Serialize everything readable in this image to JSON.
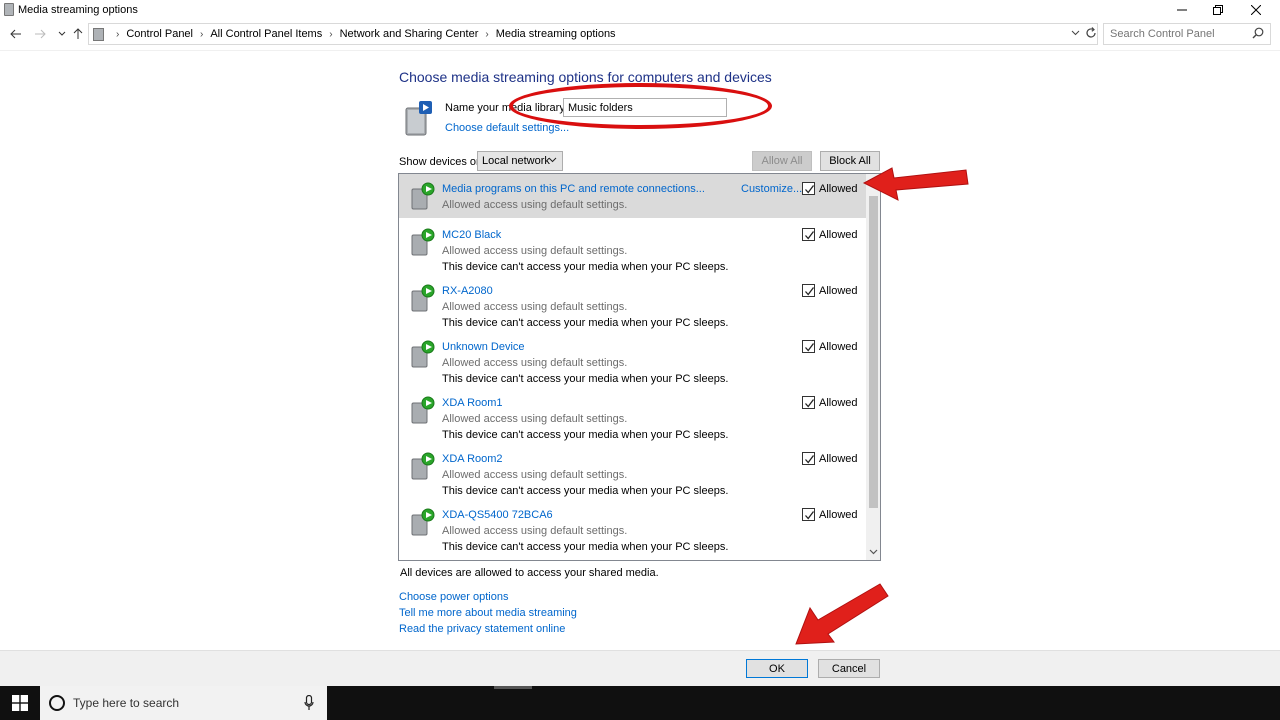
{
  "window": {
    "title": "Media streaming options"
  },
  "address": {
    "crumbs": [
      "Control Panel",
      "All Control Panel Items",
      "Network and Sharing Center",
      "Media streaming options"
    ],
    "search_placeholder": "Search Control Panel"
  },
  "content": {
    "heading": "Choose media streaming options for computers and devices",
    "library_label": "Name your media library:",
    "library_value": "Music folders",
    "default_settings_link": "Choose default settings...",
    "show_devices_label": "Show devices on:",
    "show_devices_value": "Local network",
    "allow_all": "Allow All",
    "block_all": "Block All"
  },
  "devices": [
    {
      "name": "Media programs on this PC and remote connections...",
      "sub1": "Allowed access using default settings.",
      "sub2": "",
      "customize": "Customize...",
      "status": "Allowed",
      "checked": true,
      "selected": true
    },
    {
      "name": "MC20 Black",
      "sub1": "Allowed access using default settings.",
      "sub2": "This device can't access your media when your PC sleeps.",
      "status": "Allowed",
      "checked": true
    },
    {
      "name": "RX-A2080",
      "sub1": "Allowed access using default settings.",
      "sub2": "This device can't access your media when your PC sleeps.",
      "status": "Allowed",
      "checked": true
    },
    {
      "name": "Unknown Device",
      "sub1": "Allowed access using default settings.",
      "sub2": "This device can't access your media when your PC sleeps.",
      "status": "Allowed",
      "checked": true
    },
    {
      "name": "XDA Room1",
      "sub1": "Allowed access using default settings.",
      "sub2": "This device can't access your media when your PC sleeps.",
      "status": "Allowed",
      "checked": true
    },
    {
      "name": "XDA Room2",
      "sub1": "Allowed access using default settings.",
      "sub2": "This device can't access your media when your PC sleeps.",
      "status": "Allowed",
      "checked": true
    },
    {
      "name": "XDA-QS5400 72BCA6",
      "sub1": "Allowed access using default settings.",
      "sub2": "This device can't access your media when your PC sleeps.",
      "status": "Allowed",
      "checked": true
    }
  ],
  "footer": {
    "all_allowed": "All devices are allowed to access your shared media.",
    "links": [
      "Choose power options",
      "Tell me more about media streaming",
      "Read the privacy statement online"
    ],
    "ok": "OK",
    "cancel": "Cancel"
  },
  "taskbar": {
    "search_placeholder": "Type here to search"
  },
  "colors": {
    "link": "#0066cc",
    "heading": "#1e3287",
    "annotation": "#d90f0f"
  }
}
